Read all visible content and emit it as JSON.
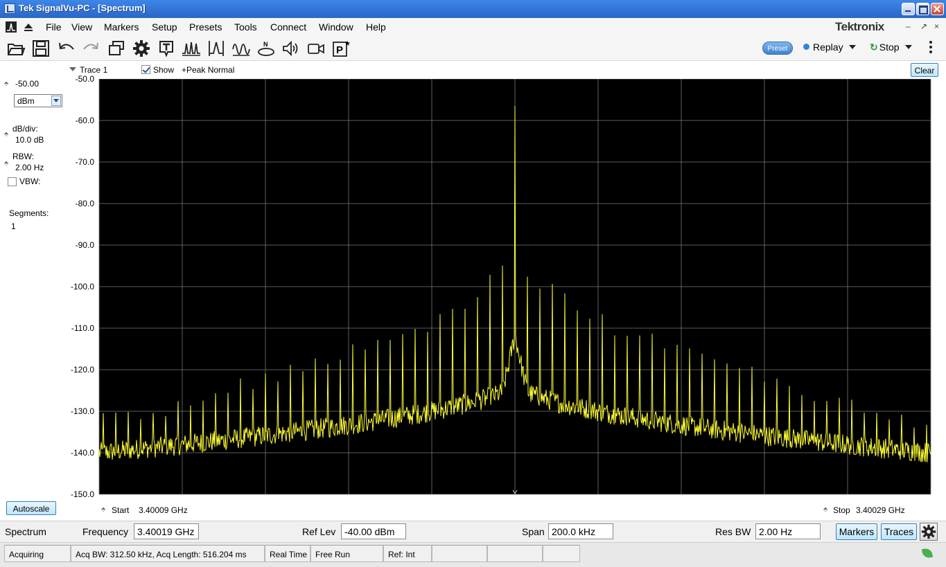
{
  "window": {
    "title": "Tek SignalVu-PC - [Spectrum]"
  },
  "menu": {
    "items": [
      "File",
      "View",
      "Markers",
      "Setup",
      "Presets",
      "Tools",
      "Connect",
      "Window",
      "Help"
    ],
    "brand": "Tektronix",
    "mdi_restore": "↗",
    "mdi_close": "×"
  },
  "toolbar": {
    "icons": [
      "open-folder-icon",
      "save-icon",
      "undo-icon",
      "redo-icon",
      "windows-icon",
      "settings-icon",
      "text-icon",
      "multi-peak-icon",
      "peak-icon",
      "waveform-icon",
      "noise-icon",
      "audio-icon",
      "camera-icon",
      "preset-p-icon"
    ],
    "preset_label": "Preset",
    "replay_label": "Replay",
    "stop_label": "Stop"
  },
  "left_panel": {
    "ref_value": "-50.00",
    "unit": "dBm",
    "db_div_label": "dB/div:",
    "db_div_value": "10.0 dB",
    "rbw_label": "RBW:",
    "rbw_value": "2.00 Hz",
    "vbw_label": "VBW:",
    "vbw_checked": false,
    "segments_label": "Segments:",
    "segments_value": "1",
    "autoscale_label": "Autoscale"
  },
  "trace_header": {
    "trace_label": "Trace 1",
    "show_label": "Show",
    "show_checked": true,
    "detector_label": "+Peak Normal",
    "clear_label": "Clear"
  },
  "chart_data": {
    "type": "line",
    "title": "",
    "xlabel": "",
    "ylabel": "",
    "y_unit": "dBm",
    "ylim": [
      -150,
      -50
    ],
    "y_ticks": [
      "-50.0",
      "-60.0",
      "-70.0",
      "-80.0",
      "-90.0",
      "-100.0",
      "-110.0",
      "-120.0",
      "-130.0",
      "-140.0",
      "-150.0"
    ],
    "x_range_ghz": [
      3.40009,
      3.40029
    ],
    "x_divisions": 10,
    "grid": true,
    "trace_color": "#ffff33",
    "series": [
      {
        "carrier_freq_ghz": 3.40019,
        "carrier_level_dbm": -56.5,
        "noise_floor_edge_dbm": -140,
        "noise_floor_near_carrier_dbm": -123,
        "spur_spacing_khz": 3.0,
        "spur_peaks_dbm_lower_side": [
          -96.5,
          -99,
          -101,
          -104,
          -106,
          -107,
          -109,
          -110,
          -111,
          -112,
          -113,
          -114.5,
          -115,
          -116,
          -117.5,
          -118,
          -119,
          -120,
          -121,
          -122,
          -123,
          -124,
          -125,
          -126,
          -127,
          -128,
          -129,
          -129.5,
          -130.5,
          -131,
          -131.5,
          -132
        ],
        "spur_peaks_dbm_upper_side": [
          -97,
          -99,
          -101,
          -103,
          -105,
          -107,
          -108,
          -110,
          -111,
          -112,
          -113,
          -114,
          -115,
          -116,
          -117,
          -118,
          -119,
          -120,
          -121,
          -122,
          -123,
          -124,
          -125,
          -126,
          -127,
          -128,
          -129,
          -130,
          -130.5,
          -131,
          -131.5,
          -132
        ]
      }
    ]
  },
  "freq_footer": {
    "start_label": "Start",
    "start_value": "3.40009 GHz",
    "stop_label": "Stop",
    "stop_value": "3.40029 GHz"
  },
  "params": {
    "display_name": "Spectrum",
    "frequency_label": "Frequency",
    "frequency_value": "3.40019 GHz",
    "ref_lev_label": "Ref Lev",
    "ref_lev_value": "-40.00 dBm",
    "span_label": "Span",
    "span_value": "200.0 kHz",
    "res_bw_label": "Res BW",
    "res_bw_value": "2.00 Hz",
    "markers_label": "Markers",
    "traces_label": "Traces"
  },
  "status": {
    "state": "Acquiring",
    "acq": "Acq BW: 312.50 kHz, Acq Length: 516.204 ms",
    "mode": "Real Time",
    "trigger": "Free Run",
    "ref": "Ref: Int"
  }
}
